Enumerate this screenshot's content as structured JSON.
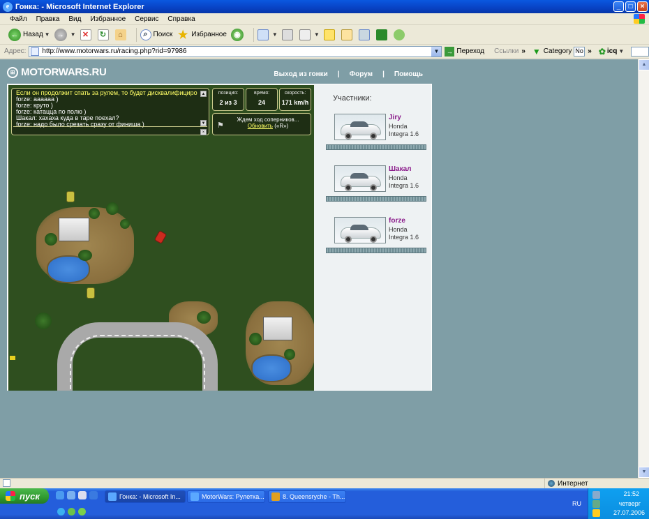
{
  "window": {
    "title": "Гонка: - Microsoft Internet Explorer"
  },
  "menu": [
    "Файл",
    "Правка",
    "Вид",
    "Избранное",
    "Сервис",
    "Справка"
  ],
  "toolbar": {
    "back": "Назад",
    "search": "Поиск",
    "favorites": "Избранное"
  },
  "address": {
    "label": "Адрес:",
    "url": "http://www.motorwars.ru/racing.php?rid=97986",
    "go": "Переход",
    "links": "Ссылки",
    "category": "Category",
    "category_value": "No",
    "icq": "icq"
  },
  "site": {
    "logo": "MOTORWARS.RU",
    "nav": [
      "Выход из гонки",
      "Форум",
      "Помощь"
    ],
    "nav_sep": "|"
  },
  "chat": {
    "lines": [
      "Если он продолжит спать за рулем, то будет дисквалифицирован.",
      "forze: аааааа )",
      "forze: круто )",
      "forze: катацца по полю )",
      "Шакал: хахаха куда в таре поехал?",
      "forze: надо было срезать сразу от финиша )"
    ]
  },
  "stats": {
    "position_label": "позиция:",
    "position": "2 из 3",
    "time_label": "время:",
    "time": "24",
    "speed_label": "скорость:",
    "speed": "171 km/h"
  },
  "wait": {
    "text": "Ждем ход соперников...",
    "refresh": "Обновить",
    "hotkey": "(«R»)"
  },
  "participants": {
    "title": "Участники:",
    "list": [
      {
        "name": "Jiry",
        "model": "Honda",
        "model2": "Integra 1.6"
      },
      {
        "name": "Шакал",
        "model": "Honda",
        "model2": "Integra 1.6"
      },
      {
        "name": "forze",
        "model": "Honda",
        "model2": "Integra 1.6"
      }
    ]
  },
  "statusbar": {
    "zone": "Интернет"
  },
  "taskbar": {
    "start": "пуск",
    "tasks": [
      "Гонка: - Microsoft In...",
      "MotorWars: Рулетка...",
      "8. Queensryche - Th..."
    ],
    "lang": "RU",
    "time": "21:52",
    "day": "четверг",
    "date": "27.07.2006"
  }
}
